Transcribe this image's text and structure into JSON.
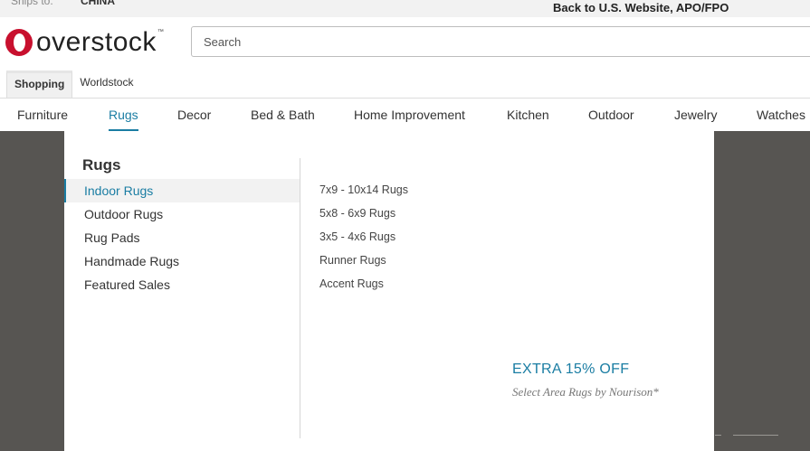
{
  "topbar": {
    "ships_to_label": "Ships to:",
    "ships_to_value": "CHINA",
    "back_link": "Back to U.S. Website, APO/FPO"
  },
  "logo": {
    "text": "overstock",
    "tm": "™"
  },
  "search": {
    "placeholder": "Search",
    "value": ""
  },
  "store_tabs": [
    {
      "label": "Shopping",
      "active": true
    },
    {
      "label": "Worldstock",
      "active": false
    }
  ],
  "categories": [
    {
      "label": "Furniture"
    },
    {
      "label": "Rugs",
      "active": true
    },
    {
      "label": "Decor"
    },
    {
      "label": "Bed & Bath"
    },
    {
      "label": "Home Improvement"
    },
    {
      "label": "Kitchen"
    },
    {
      "label": "Outdoor"
    },
    {
      "label": "Jewelry"
    },
    {
      "label": "Watches"
    }
  ],
  "dropdown": {
    "title": "Rugs",
    "subcategories": [
      {
        "label": "Indoor Rugs",
        "active": true
      },
      {
        "label": "Outdoor Rugs"
      },
      {
        "label": "Rug Pads"
      },
      {
        "label": "Handmade Rugs"
      },
      {
        "label": "Featured Sales"
      }
    ],
    "sizes": [
      {
        "label": "7x9 - 10x14 Rugs"
      },
      {
        "label": "5x8 - 6x9 Rugs"
      },
      {
        "label": "3x5 - 4x6 Rugs"
      },
      {
        "label": "Runner Rugs"
      },
      {
        "label": "Accent Rugs"
      }
    ],
    "promo": {
      "title": "EXTRA 15% OFF",
      "subtitle": "Select Area Rugs by Nourison*"
    }
  },
  "colors": {
    "accent": "#1a7da3",
    "brand": "#c8102e",
    "overlay": "#575552"
  }
}
